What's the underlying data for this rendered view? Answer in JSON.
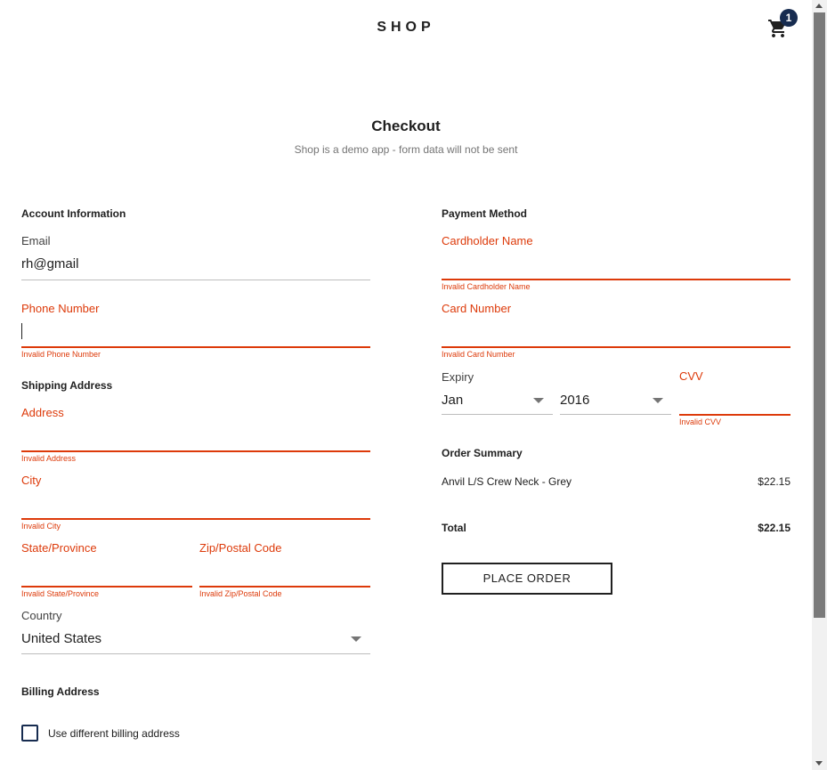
{
  "header": {
    "brand": "SHOP",
    "cart_count": "1",
    "cart_icon": "cart-icon"
  },
  "page": {
    "title": "Checkout",
    "subtitle": "Shop is a demo app - form data will not be sent"
  },
  "account": {
    "heading": "Account Information",
    "email": {
      "label": "Email",
      "value": "rh@gmail"
    },
    "phone": {
      "label": "Phone Number",
      "value": "",
      "error": "Invalid Phone Number"
    }
  },
  "shipping": {
    "heading": "Shipping Address",
    "address": {
      "label": "Address",
      "error": "Invalid Address"
    },
    "city": {
      "label": "City",
      "error": "Invalid City"
    },
    "state": {
      "label": "State/Province",
      "error": "Invalid State/Province"
    },
    "zip": {
      "label": "Zip/Postal Code",
      "error": "Invalid Zip/Postal Code"
    },
    "country": {
      "label": "Country",
      "value": "United States"
    }
  },
  "billing": {
    "heading": "Billing Address",
    "checkbox_label": "Use different billing address",
    "checked": false
  },
  "payment": {
    "heading": "Payment Method",
    "cardholder": {
      "label": "Cardholder Name",
      "error": "Invalid Cardholder Name"
    },
    "card_number": {
      "label": "Card Number",
      "error": "Invalid Card Number"
    },
    "expiry": {
      "label": "Expiry",
      "month": "Jan",
      "year": "2016"
    },
    "cvv": {
      "label": "CVV",
      "error": "Invalid CVV"
    }
  },
  "summary": {
    "heading": "Order Summary",
    "items": [
      {
        "name": "Anvil L/S Crew Neck - Grey",
        "price": "$22.15"
      }
    ],
    "total_label": "Total",
    "total_value": "$22.15"
  },
  "actions": {
    "place_order": "PLACE ORDER"
  },
  "colors": {
    "error": "#dd3a0a",
    "badge": "#172c50",
    "text": "#202020",
    "muted": "#757575"
  }
}
